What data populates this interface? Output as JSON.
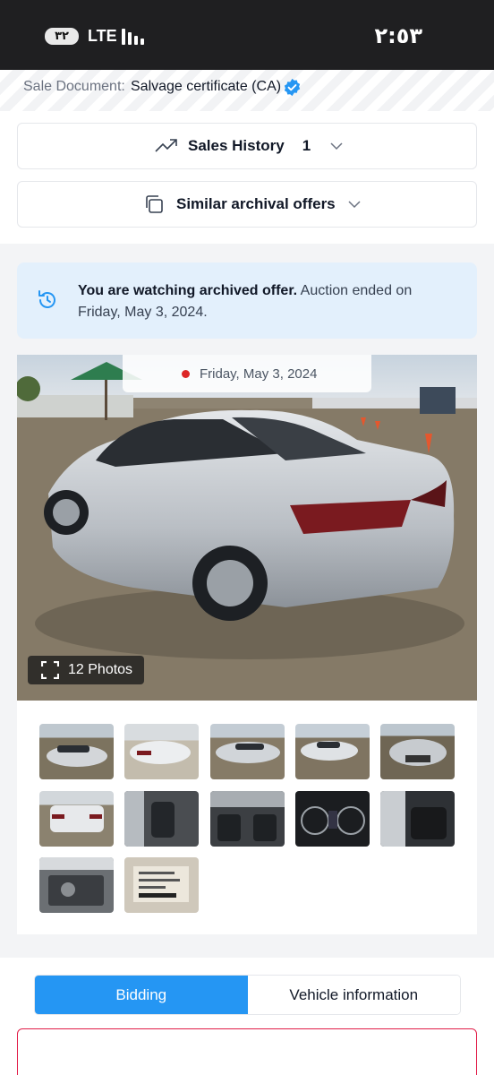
{
  "status_bar": {
    "battery": "٣٢",
    "network": "LTE",
    "time": "٢:٥٣"
  },
  "sale_document": {
    "label": "Sale Document:",
    "value": "Salvage certificate (CA)"
  },
  "sales_history": {
    "label": "Sales History",
    "count": "1"
  },
  "similar_offers": {
    "label": "Similar archival offers"
  },
  "archive_banner": {
    "bold": "You are watching archived offer.",
    "text": " Auction ended on Friday, May 3, 2024."
  },
  "gallery": {
    "date": "Friday, May 3, 2024",
    "photos_label": "12 Photos",
    "thumbnails": [
      "car-exterior-left",
      "car-exterior-rear",
      "car-exterior-side",
      "car-exterior-front-damage",
      "car-front-damage",
      "car-rear",
      "car-interior-front",
      "car-interior-dashboard",
      "car-gauge-cluster",
      "car-interior-rear",
      "car-engine-bay",
      "car-info-label"
    ]
  },
  "tabs": {
    "active": "Bidding",
    "inactive": "Vehicle information"
  },
  "colors": {
    "accent": "#2596f3",
    "banner_bg": "#e3f0fc",
    "alert_border": "#e11d48"
  }
}
